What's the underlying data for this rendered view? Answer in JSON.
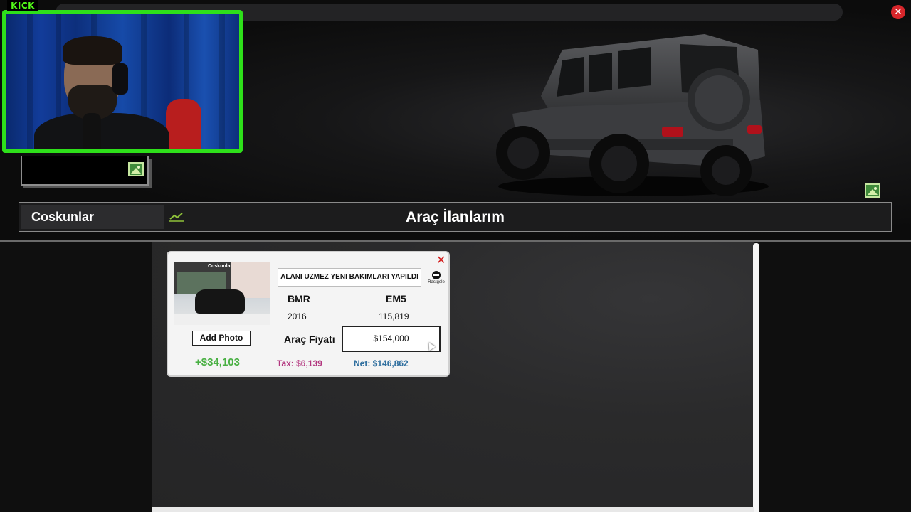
{
  "stream": {
    "platform_badge": "KICK"
  },
  "window": {
    "close_label": "✕"
  },
  "header": {
    "shop_name": "Coskunlar",
    "title": "Araç İlanlarım"
  },
  "listing": {
    "close_label": "✕",
    "description": "ALANI UZMEZ YENI BAKIMLARI YAPILDI",
    "random_label": "Rastgele",
    "thumb_sign": "Coskunlar",
    "brand": "BMR",
    "model": "EM5",
    "year": "2016",
    "mileage": "115,819",
    "add_photo_label": "Add Photo",
    "price_label": "Araç Fiyatı",
    "price_value": "$154,000",
    "profit": "+$34,103",
    "tax": "Tax: $6,139",
    "net": "Net: $146,862"
  },
  "colors": {
    "accent_green": "#2ee01a",
    "close_red": "#d7262b",
    "profit_green": "#49b043",
    "tax_magenta": "#b2357e",
    "net_blue": "#2f6f9f"
  },
  "icons": {
    "image_placeholder": "image-icon",
    "chart": "chart-line-icon",
    "random": "dice-icon",
    "close": "close-icon"
  }
}
